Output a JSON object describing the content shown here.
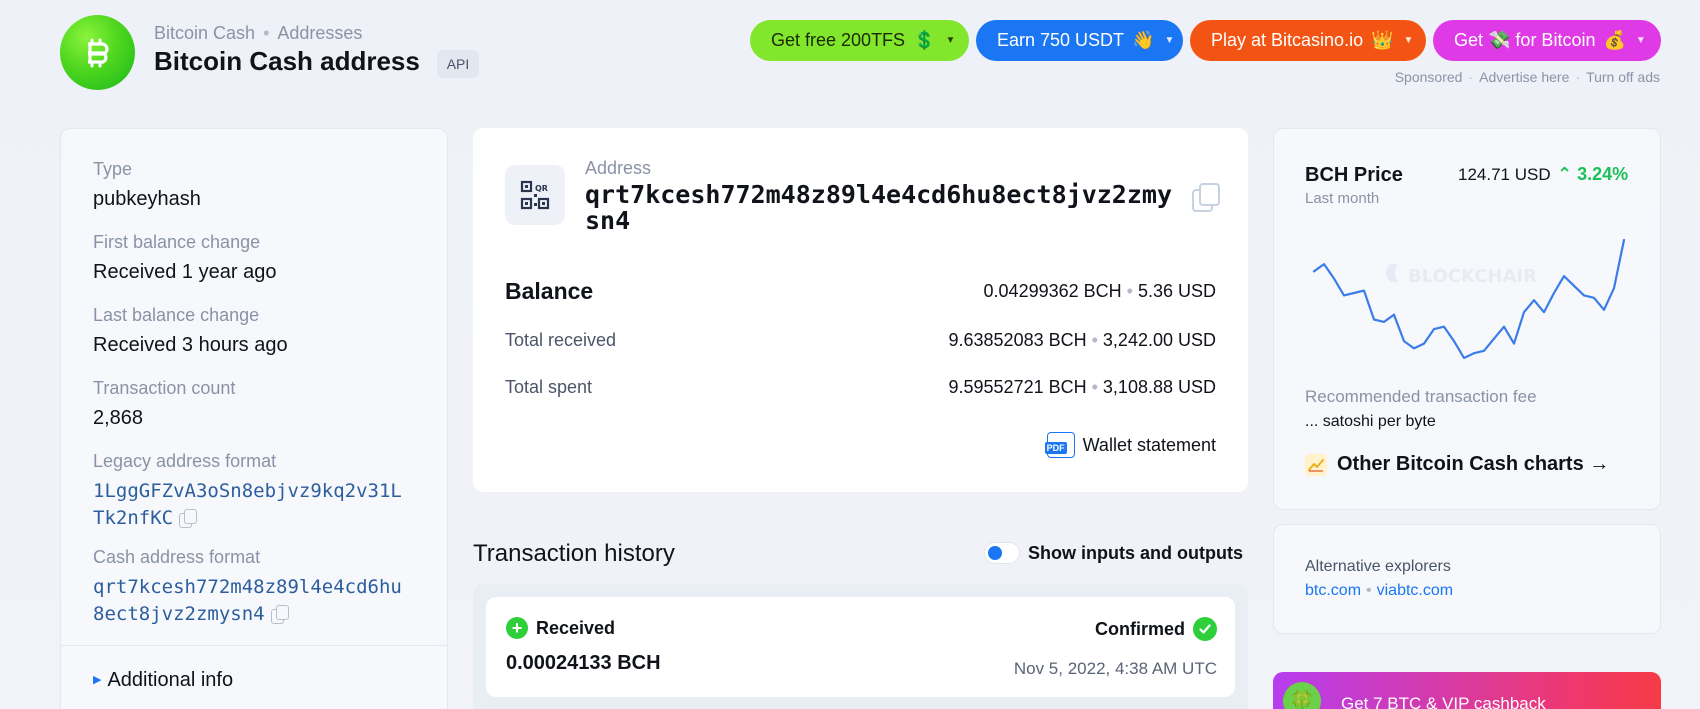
{
  "header": {
    "breadcrumb": [
      "Bitcoin Cash",
      "Addresses"
    ],
    "title": "Bitcoin Cash address",
    "api_badge": "API"
  },
  "ads": [
    {
      "label": "Get free 200TFS",
      "emoji": "💲",
      "color": "#82e62c"
    },
    {
      "label": "Earn 750 USDT",
      "emoji": "👋",
      "color": "#1a76f2"
    },
    {
      "label": "Play at Bitcasino.io",
      "emoji": "👑",
      "color": "#f45413"
    },
    {
      "label": "Get 💸 for Bitcoin",
      "emoji": "💰",
      "color": "#e039e6"
    }
  ],
  "ad_links": [
    "Sponsored",
    "Advertise here",
    "Turn off ads"
  ],
  "details": {
    "type_label": "Type",
    "type_value": "pubkeyhash",
    "first_label": "First balance change",
    "first_value": "Received 1 year ago",
    "last_label": "Last balance change",
    "last_value": "Received 3 hours ago",
    "count_label": "Transaction count",
    "count_value": "2,868",
    "legacy_label": "Legacy address format",
    "legacy_value": "1LggGFZvA3oSn8ebjvz9kq2v31LTk2nfKC",
    "cash_label": "Cash address format",
    "cash_value": "qrt7kcesh772m48z89l4e4cd6hu8ect8jvz2zmysn4",
    "additional": "Additional info"
  },
  "address": {
    "label": "Address",
    "value": "qrt7kcesh772m48z89l4e4cd6hu8ect8jvz2zmysn4"
  },
  "balance": {
    "balance_label": "Balance",
    "balance_bch": "0.04299362 BCH",
    "balance_usd": "5.36 USD",
    "received_label": "Total received",
    "received_bch": "9.63852083 BCH",
    "received_usd": "3,242.00 USD",
    "spent_label": "Total spent",
    "spent_bch": "9.59552721 BCH",
    "spent_usd": "3,108.88 USD",
    "wallet_statement": "Wallet statement",
    "pdf_tag": "PDF"
  },
  "history": {
    "title": "Transaction history",
    "toggle_label": "Show inputs and outputs",
    "tx": {
      "type": "Received",
      "amount": "0.00024133 BCH",
      "status": "Confirmed",
      "time": "Nov 5, 2022, 4:38 AM UTC"
    }
  },
  "price": {
    "title": "BCH Price",
    "period": "Last month",
    "value": "124.71 USD",
    "change": "3.24%",
    "change_color": "#1dbf5b",
    "watermark": "BLOCKCHAIR",
    "fee_label": "Recommended transaction fee",
    "fee_value": "... satoshi per byte",
    "other_charts": "Other Bitcoin Cash charts →"
  },
  "chart_data": {
    "type": "line",
    "values": [
      124,
      127,
      121,
      114,
      115,
      116,
      104,
      103,
      106,
      95,
      92,
      94,
      100,
      101,
      95,
      88,
      90,
      91,
      96,
      101,
      94,
      107,
      112,
      107,
      115,
      122,
      118,
      114,
      113,
      108,
      117,
      137
    ]
  },
  "alternatives": {
    "label": "Alternative explorers",
    "links": [
      "btc.com",
      "viabtc.com"
    ]
  },
  "promo": {
    "text": "Get 7 BTC & VIP cashback",
    "icon": "🍀"
  }
}
